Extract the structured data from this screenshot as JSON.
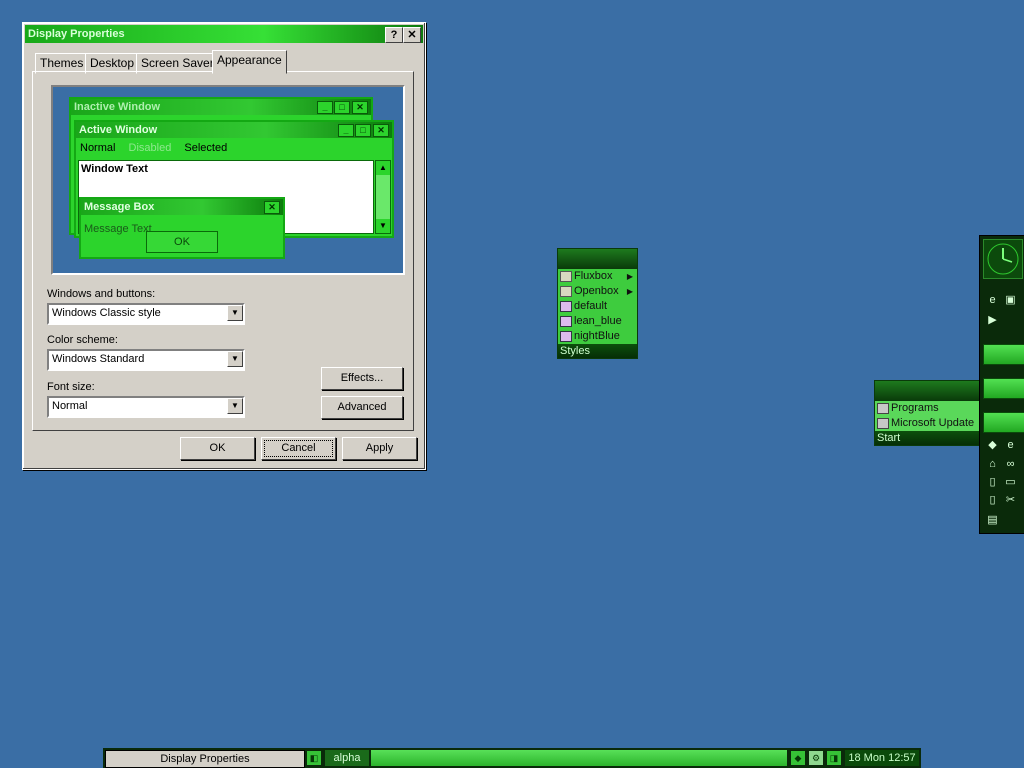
{
  "dialog": {
    "title": "Display Properties",
    "help_label": "?",
    "close_label": "✕",
    "tabs": [
      "Themes",
      "Desktop",
      "Screen Saver",
      "Appearance"
    ],
    "active_tab": "Appearance",
    "preview": {
      "inactive_title": "Inactive Window",
      "active_title": "Active Window",
      "menu_normal": "Normal",
      "menu_disabled": "Disabled",
      "menu_selected": "Selected",
      "window_text": "Window Text",
      "msgbox_title": "Message Box",
      "msgbox_text": "Message Text",
      "ok_label": "OK"
    },
    "windows_buttons_label": "Windows and buttons:",
    "windows_buttons_value": "Windows Classic style",
    "color_scheme_label": "Color scheme:",
    "color_scheme_value": "Windows Standard",
    "font_size_label": "Font size:",
    "font_size_value": "Normal",
    "effects_label": "Effects...",
    "advanced_label": "Advanced",
    "ok_label": "OK",
    "cancel_label": "Cancel",
    "apply_label": "Apply"
  },
  "styles_menu": {
    "items": [
      {
        "label": "Fluxbox",
        "submenu": true
      },
      {
        "label": "Openbox",
        "submenu": true
      },
      {
        "label": "default",
        "submenu": false
      },
      {
        "label": "lean_blue",
        "submenu": false
      },
      {
        "label": "nightBlue",
        "submenu": false
      }
    ],
    "footer": "Styles"
  },
  "start_menu": {
    "items": [
      "Programs",
      "Microsoft Update"
    ],
    "footer": "Start"
  },
  "taskbar": {
    "task_label": "Display Properties",
    "workspace_label": "alpha",
    "clock": "18 Mon 12:57"
  },
  "colors": {
    "desktop": "#3a6ea5",
    "accent_green": "#36e036",
    "dark_green": "#0a2a0a"
  }
}
